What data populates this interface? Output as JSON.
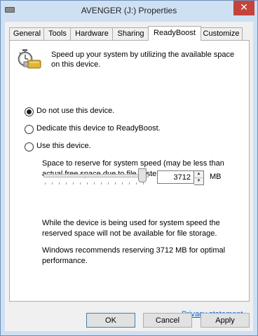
{
  "window": {
    "title": "AVENGER (J:) Properties",
    "close_glyph": "✕"
  },
  "tabs": [
    {
      "label": "General"
    },
    {
      "label": "Tools"
    },
    {
      "label": "Hardware"
    },
    {
      "label": "Sharing"
    },
    {
      "label": "ReadyBoost",
      "active": true
    },
    {
      "label": "Customize"
    }
  ],
  "readyboost": {
    "icon": "readyboost-stopwatch-icon",
    "intro": "Speed up your system by utilizing the available space on this device.",
    "options": [
      {
        "label": "Do not use this device.",
        "checked": true
      },
      {
        "label": "Dedicate this device to ReadyBoost.",
        "checked": false
      },
      {
        "label": "Use this device.",
        "checked": false
      }
    ],
    "reserve_label": "Space to reserve for system speed (may be less than actual free space due to file system limits):",
    "reserve_value": "3712",
    "reserve_unit": "MB",
    "note_storage": "While the device is being used for system speed the reserved space will not be available for file storage.",
    "note_recommend": "Windows recommends reserving 3712 MB for optimal performance.",
    "privacy_link": "Privacy statement"
  },
  "buttons": {
    "ok": "OK",
    "cancel": "Cancel",
    "apply": "Apply"
  }
}
